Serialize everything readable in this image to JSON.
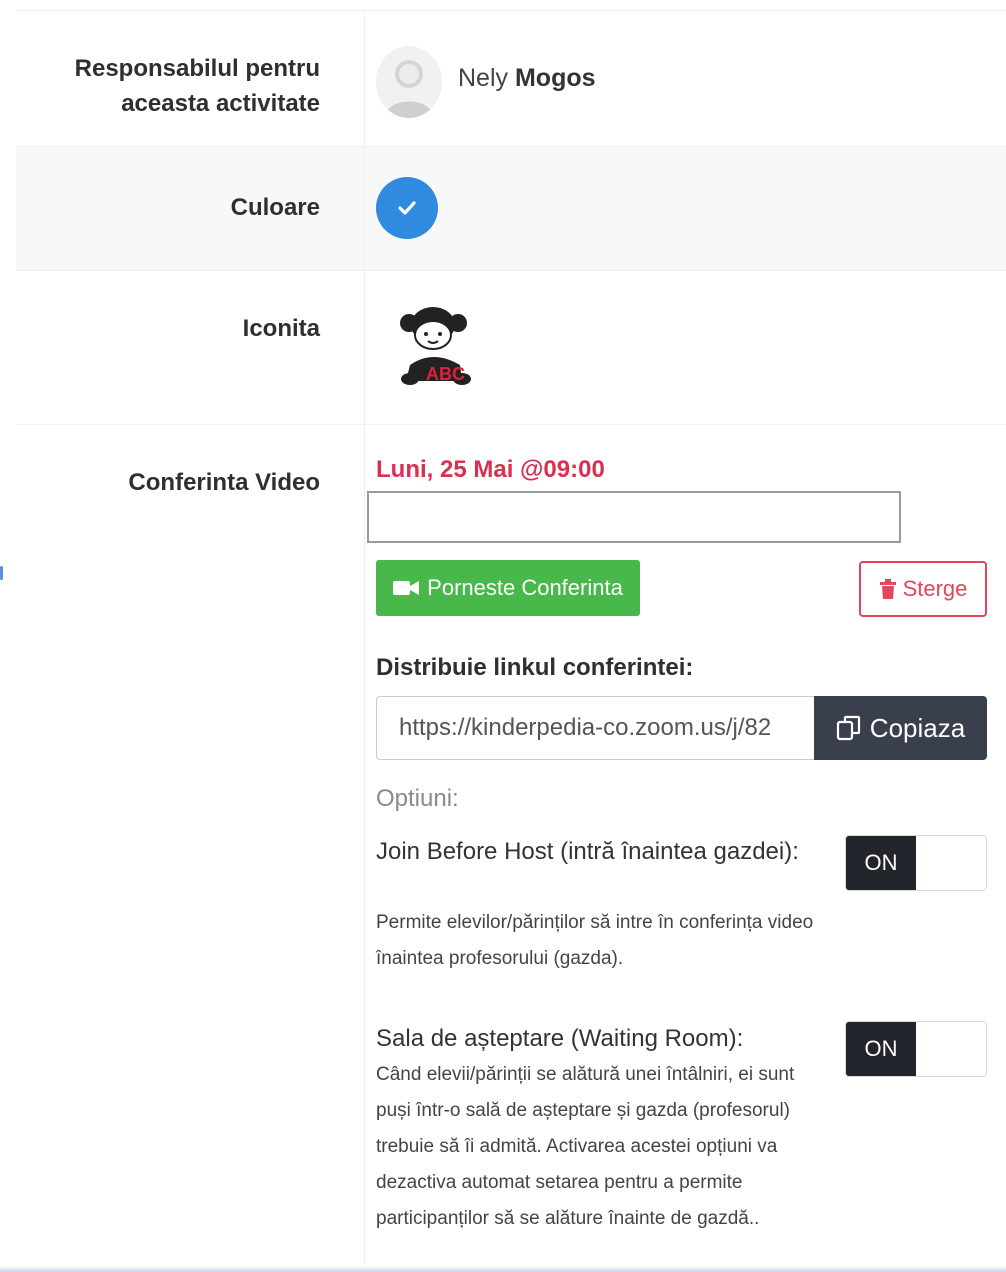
{
  "fields": {
    "responsible_label": "Responsabilul pentru aceasta activitate",
    "responsible_first_name": "Nely",
    "responsible_last_name": "Mogos",
    "color_label": "Culoare",
    "icon_label": "Iconita",
    "icon_letters": "ABC",
    "video_label": "Conferinta Video"
  },
  "conference": {
    "date": "Luni, 25 Mai @09:00",
    "text_value": "",
    "start_button": "Porneste Conferinta",
    "delete_button": "Sterge",
    "share_label": "Distribuie linkul conferintei:",
    "link_value": "https://kinderpedia-co.zoom.us/j/82",
    "copy_button": "Copiaza",
    "options_title": "Optiuni:",
    "options": [
      {
        "title": "Join Before Host (intră înaintea gazdei):",
        "description": "Permite elevilor/părinților să intre în conferința video înaintea profesorului (gazda).",
        "state": "ON"
      },
      {
        "title": "Sala de așteptare (Waiting Room):",
        "description": "Când elevii/părinții se alătură unei întâlniri, ei sunt puși într-o sală de așteptare și gazda (profesorul) trebuie să îi admită. Activarea acestei opțiuni va dezactiva automat setarea pentru a permite participanților să se alăture înainte de gazdă..",
        "state": "ON"
      }
    ]
  },
  "colors": {
    "selected_color": "#2f8ae0",
    "date_red": "#d9304f",
    "start_green": "#49b84a",
    "delete_red": "#e2455c",
    "copy_dark": "#3a3f4e",
    "toggle_dark": "#22252c"
  },
  "icons": {
    "avatar": "user-avatar-icon",
    "check": "check-icon",
    "activity": "child-abc-icon",
    "camera": "video-camera-icon",
    "trash": "trash-icon",
    "copy": "copy-icon"
  }
}
